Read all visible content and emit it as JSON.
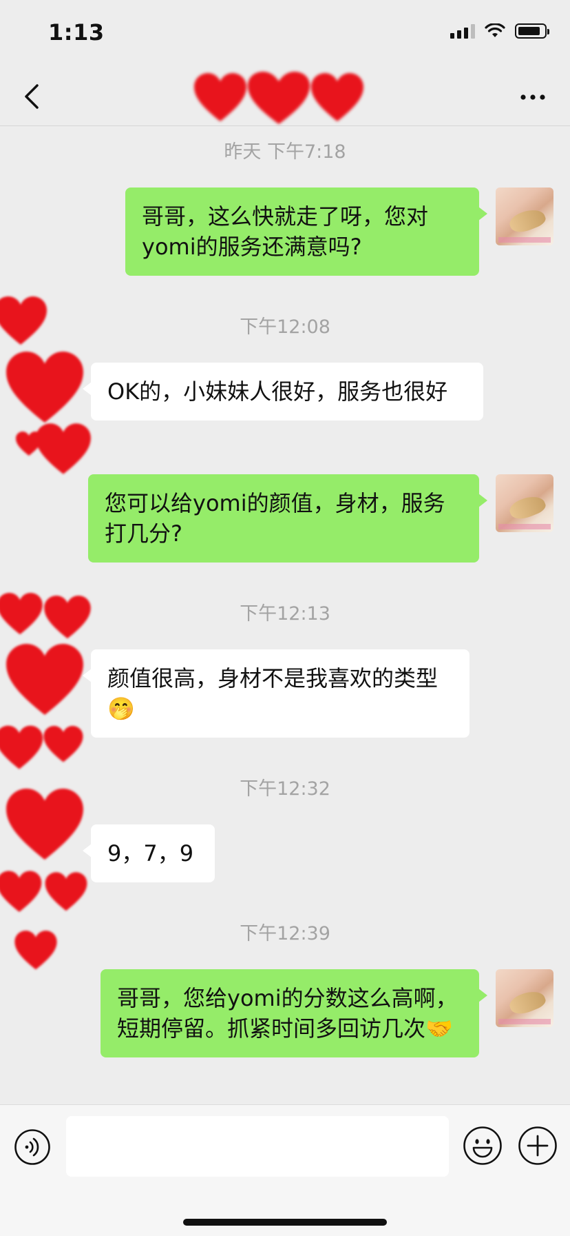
{
  "status_bar": {
    "time": "1:13"
  },
  "nav": {
    "title_hearts": "❤❤❤"
  },
  "messages": [
    {
      "type": "timestamp",
      "text": "昨天 下午7:18"
    },
    {
      "type": "outgoing",
      "text": "哥哥，这么快就走了呀，您对yomi的服务还满意吗?"
    },
    {
      "type": "timestamp",
      "text": "下午12:08"
    },
    {
      "type": "incoming",
      "text": "OK的，小妹妹人很好，服务也很好"
    },
    {
      "type": "outgoing",
      "text": "您可以给yomi的颜值，身材，服务打几分?"
    },
    {
      "type": "timestamp",
      "text": "下午12:13"
    },
    {
      "type": "incoming",
      "text": "颜值很高，身材不是我喜欢的类型🤭"
    },
    {
      "type": "timestamp",
      "text": "下午12:32"
    },
    {
      "type": "incoming",
      "text": "9，7，9"
    },
    {
      "type": "timestamp",
      "text": "下午12:39"
    },
    {
      "type": "outgoing",
      "text": "哥哥，您给yomi的分数这么高啊，短期停留。抓紧时间多回访几次🤝"
    }
  ],
  "input": {
    "placeholder": ""
  },
  "icons": {
    "back": "chevron-left-icon",
    "more": "more-dots-icon",
    "voice": "voice-icon",
    "emoji": "emoji-icon",
    "plus": "plus-icon",
    "privacy_mask": "heart-emoji"
  },
  "colors": {
    "background": "#ededed",
    "outgoing_bubble": "#95ec69",
    "incoming_bubble": "#ffffff",
    "timestamp_text": "#a3a3a3",
    "heart": "#e8141c"
  }
}
